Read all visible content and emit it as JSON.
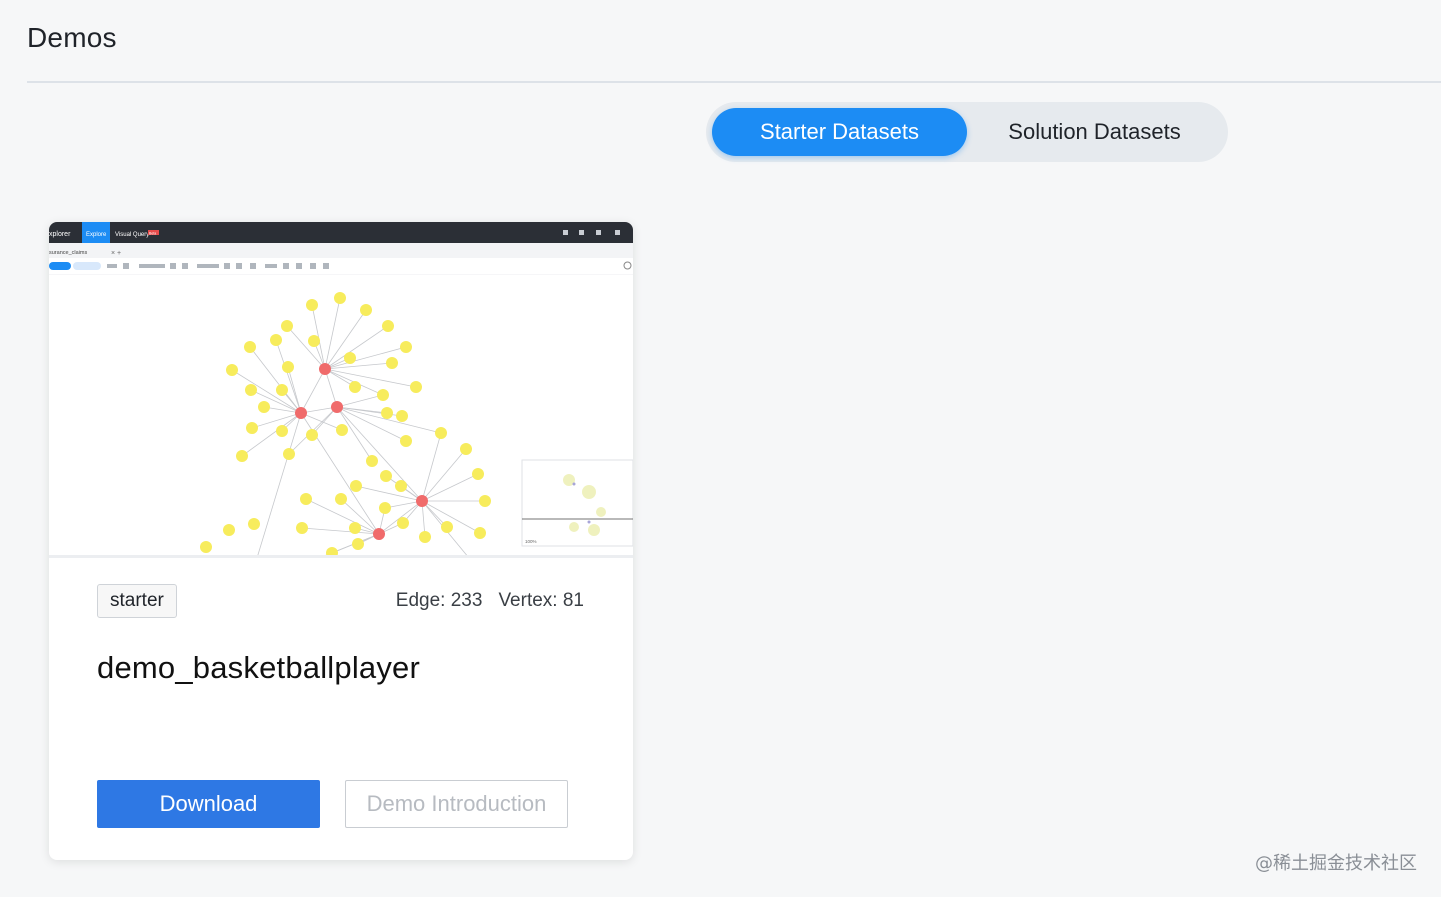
{
  "page": {
    "title": "Demos"
  },
  "tabs": [
    {
      "label": "Starter Datasets",
      "active": true
    },
    {
      "label": "Solution Datasets",
      "active": false
    }
  ],
  "card": {
    "tag": "starter",
    "edge_label": "Edge: 233",
    "vertex_label": "Vertex: 81",
    "name": "demo_basketballplayer",
    "download_label": "Download",
    "intro_label": "Demo Introduction",
    "thumbnail": {
      "app_name": "xplorer",
      "nav_explore": "Explore",
      "nav_visual_query": "Visual Query",
      "badge": "Beta",
      "tab_name": "surance_claims",
      "zoom_text": "100%"
    }
  },
  "watermark": "@稀土掘金技术社区",
  "colors": {
    "accent": "#1c8cf4",
    "download": "#2e78e4",
    "node_primary": "#f06b6b",
    "node_secondary": "#f7ec5c"
  }
}
